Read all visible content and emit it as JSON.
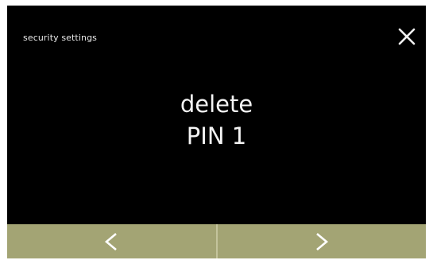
{
  "header": {
    "title": "security settings",
    "close_icon": "close-icon"
  },
  "message": {
    "line1": "delete",
    "line2": "PIN 1"
  },
  "navigation": {
    "previous_icon": "chevron-left-icon",
    "next_icon": "chevron-right-icon",
    "bar_color": "#a3a474"
  },
  "colors": {
    "background": "#000000",
    "text": "#f4f4f4"
  }
}
